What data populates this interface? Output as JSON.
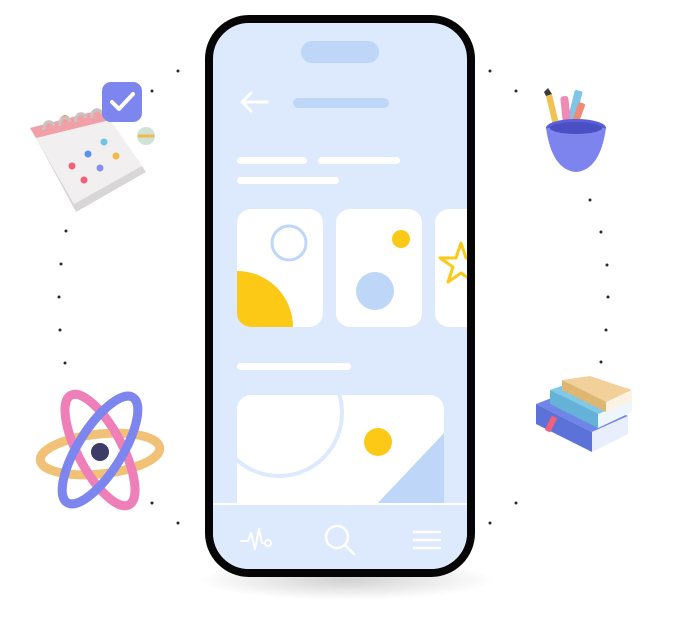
{
  "app": {
    "accent_color": "#fcc917",
    "screen_color": "#dde9fc",
    "soft_blue": "#bed6f8",
    "header": {
      "back_icon": "arrow-left-icon"
    },
    "cards": [
      {
        "icon": "circle-outline-icon"
      },
      {
        "icon": "dot-and-circle-icon"
      },
      {
        "icon": "star-outline-icon"
      }
    ],
    "feature_card": {
      "icon": "landscape-image-icon"
    },
    "tab_bar": {
      "items": [
        {
          "icon": "pulse-heartbeat-icon"
        },
        {
          "icon": "search-icon"
        },
        {
          "icon": "menu-icon"
        }
      ]
    }
  },
  "decorations": [
    {
      "icon": "calendar-icon"
    },
    {
      "icon": "pencil-cup-icon"
    },
    {
      "icon": "atom-icon"
    },
    {
      "icon": "book-stack-icon"
    }
  ]
}
